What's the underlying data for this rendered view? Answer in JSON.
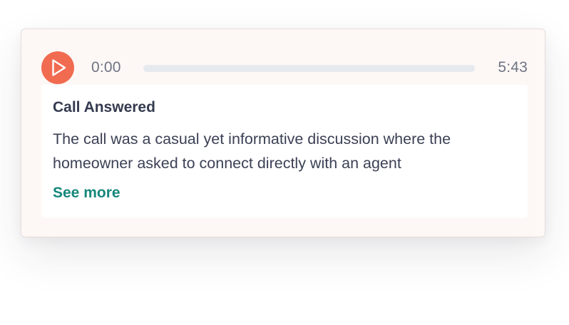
{
  "player": {
    "current_time": "0:00",
    "total_time": "5:43",
    "progress": 0,
    "play_icon": "play-icon",
    "accent_color": "#f16b51"
  },
  "summary": {
    "title": "Call Answered",
    "text": "The call was a casual yet informative discussion where the homeowner asked to connect directly with an agent",
    "see_more_label": "See more",
    "link_color": "#16877c"
  }
}
